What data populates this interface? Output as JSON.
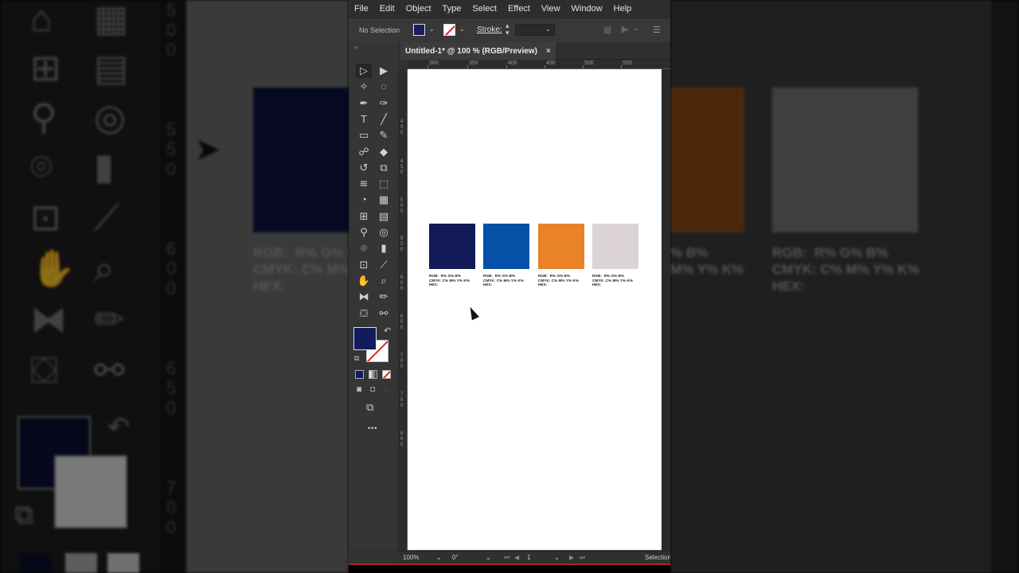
{
  "menu": [
    "File",
    "Edit",
    "Object",
    "Type",
    "Select",
    "Effect",
    "View",
    "Window",
    "Help"
  ],
  "control_bar": {
    "selection_status": "No Selection",
    "stroke_label": "Stroke:",
    "fill_color": "#1a1e5c"
  },
  "document_tab": {
    "title": "Untitled-1* @ 100 % (RGB/Preview)",
    "close": "×"
  },
  "ruler_top_labels": [
    "300",
    "350",
    "400",
    "450",
    "500",
    "550"
  ],
  "ruler_left_digits": [
    "4",
    "0",
    "0",
    "4",
    "5",
    "0",
    "5",
    "0",
    "0",
    "5",
    "5",
    "0",
    "6",
    "0",
    "0",
    "6",
    "5",
    "0",
    "7",
    "0",
    "0",
    "7",
    "5",
    "0",
    "8",
    "0",
    "0"
  ],
  "swatches": [
    {
      "color": "#121a57",
      "text": "RGB:  R% G% B%\nCMYK: C% M% Y% K%\nHEX:"
    },
    {
      "color": "#0750a8",
      "text": "RGB:  R% G% B%\nCMYK: C% M% Y% K%\nHEX:"
    },
    {
      "color": "#ea8229",
      "text": "RGB:  R% G% B%\nCMYK: C% M% Y% K%\nHEX:"
    },
    {
      "color": "#dcd4d4",
      "text": "RGB:  R% G% B%\nCMYK: C% M% Y% K%\nHEX:"
    }
  ],
  "status_bar": {
    "zoom": "100%",
    "rotation": "0°",
    "artboard_number": "1",
    "tool_name": "Selection"
  },
  "toolbar": {
    "more_tools": "•••",
    "fill_color": "#121b5c",
    "tools": [
      {
        "name": "selection-tool",
        "glyph": "▷"
      },
      {
        "name": "direct-selection-tool",
        "glyph": "▶"
      },
      {
        "name": "magic-wand-tool",
        "glyph": "✧"
      },
      {
        "name": "lasso-tool",
        "glyph": "◌"
      },
      {
        "name": "pen-tool",
        "glyph": "✒"
      },
      {
        "name": "curvature-tool",
        "glyph": "✑"
      },
      {
        "name": "type-tool",
        "glyph": "T"
      },
      {
        "name": "line-segment-tool",
        "glyph": "╱"
      },
      {
        "name": "rectangle-tool",
        "glyph": "▭"
      },
      {
        "name": "paintbrush-tool",
        "glyph": "✎"
      },
      {
        "name": "shaper-tool",
        "glyph": "☍"
      },
      {
        "name": "eraser-tool",
        "glyph": "◆"
      },
      {
        "name": "rotate-tool",
        "glyph": "↺"
      },
      {
        "name": "scale-tool",
        "glyph": "⧉"
      },
      {
        "name": "width-tool",
        "glyph": "≋"
      },
      {
        "name": "free-transform-tool",
        "glyph": "⬚"
      },
      {
        "name": "shape-builder-tool",
        "glyph": "◔"
      },
      {
        "name": "perspective-grid-tool",
        "glyph": "▦"
      },
      {
        "name": "mesh-tool",
        "glyph": "⊞"
      },
      {
        "name": "gradient-tool",
        "glyph": "▤"
      },
      {
        "name": "eyedropper-tool",
        "glyph": "⚲"
      },
      {
        "name": "blend-tool",
        "glyph": "◎"
      },
      {
        "name": "symbol-sprayer-tool",
        "glyph": "⌾"
      },
      {
        "name": "column-graph-tool",
        "glyph": "▮"
      },
      {
        "name": "artboard-tool",
        "glyph": "⊡"
      },
      {
        "name": "slice-tool",
        "glyph": "⟋"
      },
      {
        "name": "hand-tool",
        "glyph": "✋"
      },
      {
        "name": "zoom-tool",
        "glyph": "⌕"
      },
      {
        "name": "reflect-tool",
        "glyph": "⧓"
      },
      {
        "name": "pencil-tool",
        "glyph": "✏"
      },
      {
        "name": "live-paint-bucket-tool",
        "glyph": "⛋"
      },
      {
        "name": "eyedropper-alt-tool",
        "glyph": "⚯"
      }
    ]
  },
  "background": {
    "left_digits": [
      "5",
      "0",
      "0",
      "5",
      "5",
      "0",
      "6",
      "0",
      "0",
      "6",
      "5",
      "0",
      "7",
      "0",
      "0"
    ],
    "left_text": "RGB:  R% G% B\nCMYK: C% M% \nHEX:",
    "right_text_1": "% B%\nM% Y% K%",
    "right_text_2": "RGB:  R% G% B%\nCMYK: C% M% Y% K%\nHEX:",
    "left_swatch": "#0d1240",
    "right_swatch_1": "#8a4a15",
    "right_swatch_2": "#767373"
  }
}
